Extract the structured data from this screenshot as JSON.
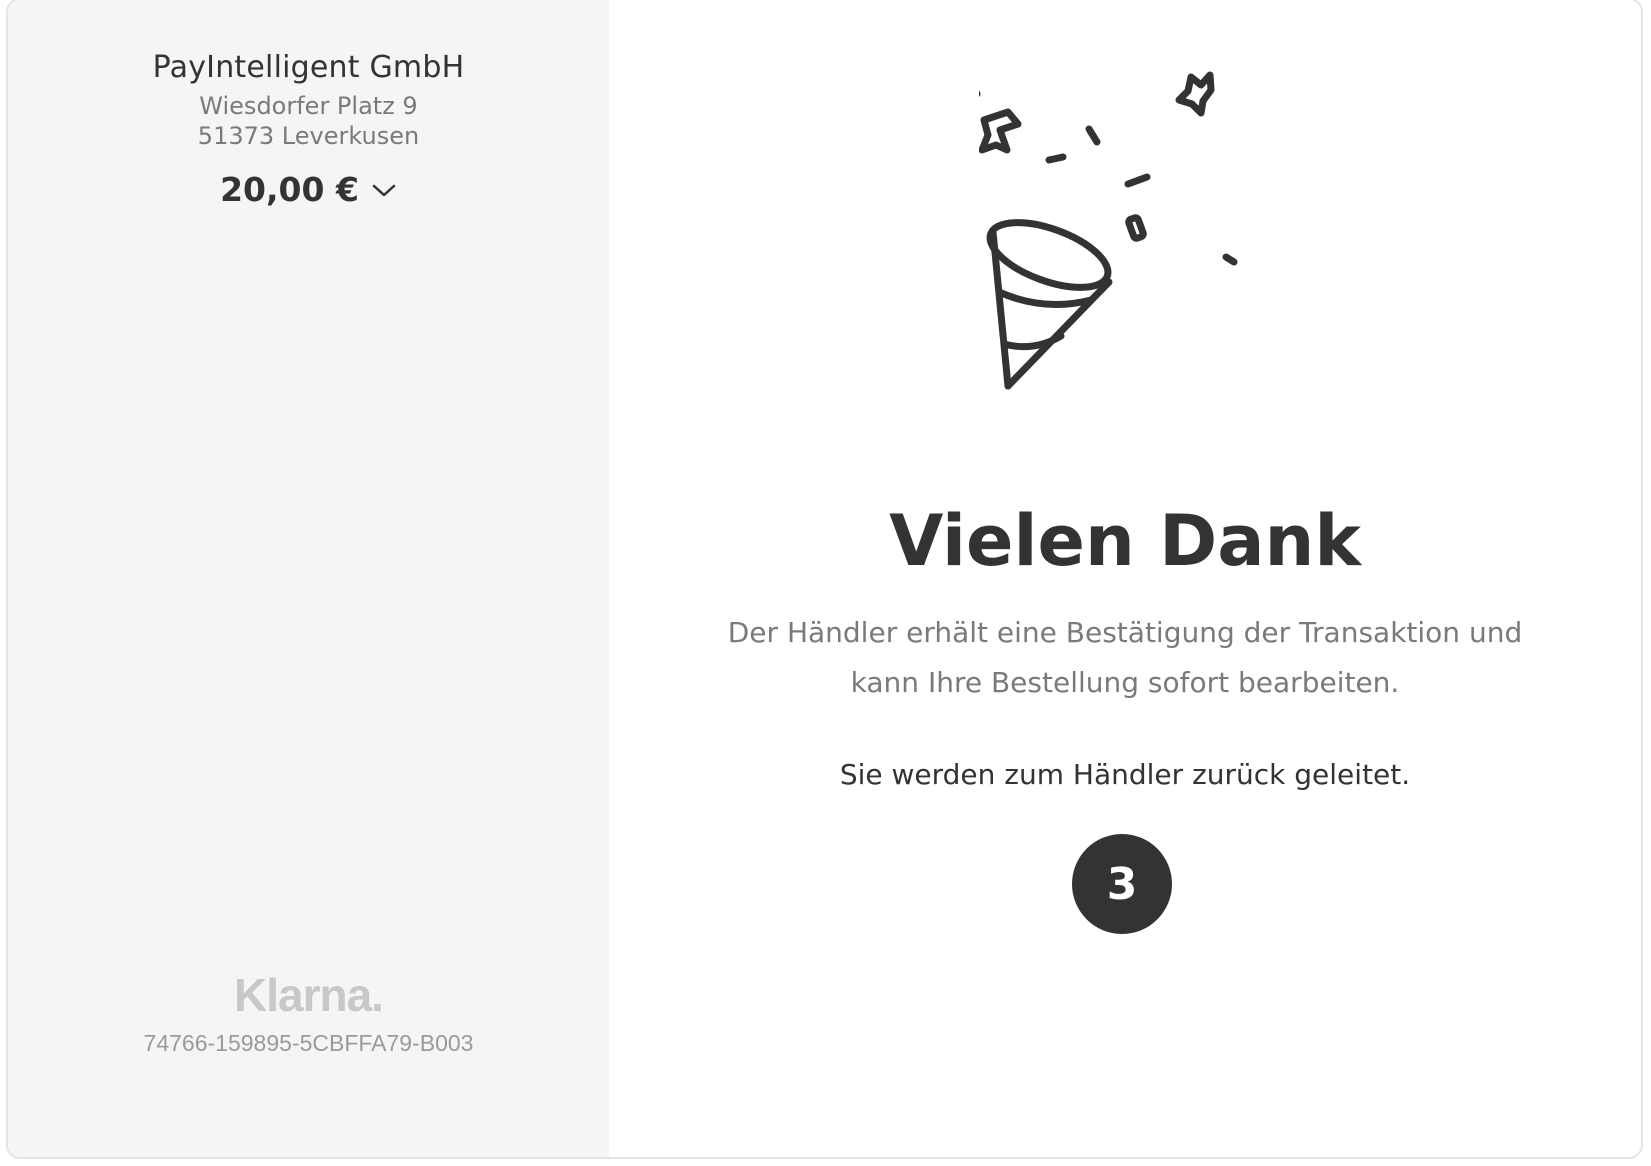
{
  "merchant": {
    "name": "PayIntelligent GmbH",
    "address_line1": "Wiesdorfer Platz 9",
    "address_line2": "51373 Leverkusen",
    "amount": "20,00 €"
  },
  "footer": {
    "logo_text": "Klarna.",
    "transaction_id": "74766-159895-5CBFFA79-B003"
  },
  "confirmation": {
    "title": "Vielen Dank",
    "description": "Der Händler erhält eine Bestätigung der Transaktion und kann Ihre Bestellung sofort bearbeiten.",
    "redirect_text": "Sie werden zum Händler zurück geleitet.",
    "countdown": "3"
  },
  "icons": {
    "illustration": "party-popper-icon",
    "amount_toggle": "chevron-down-icon"
  },
  "colors": {
    "sidebar_bg": "#f5f5f5",
    "primary_text": "#333333",
    "secondary_text": "#7a7a7a",
    "countdown_bg": "#333333"
  }
}
